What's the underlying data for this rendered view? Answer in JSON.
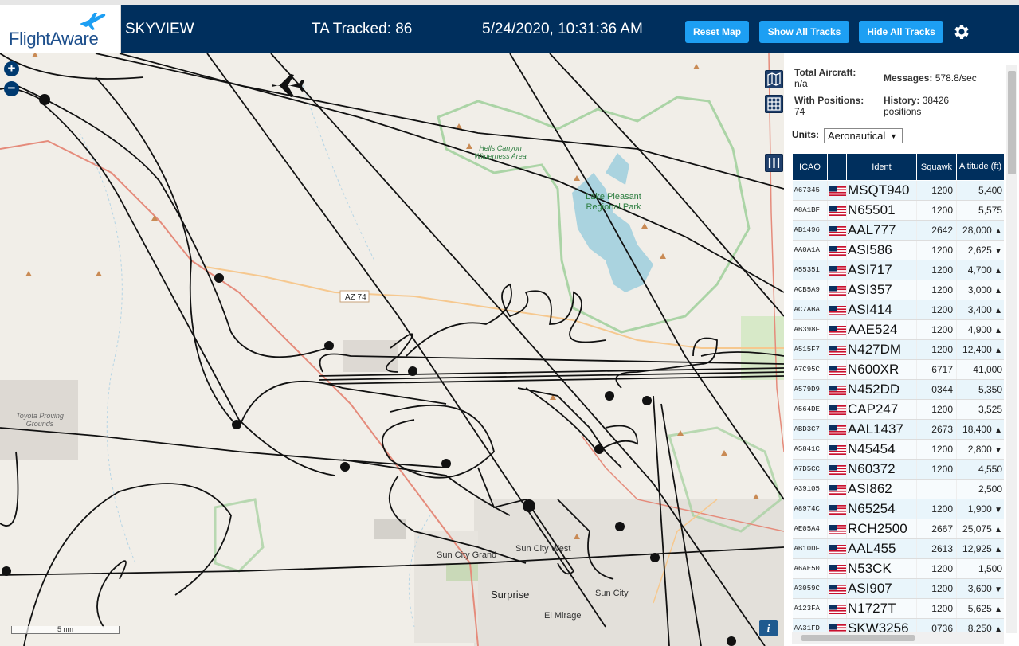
{
  "header": {
    "logo_text": "FlightAware",
    "app_name": "SKYVIEW",
    "tracked": "TA Tracked: 86",
    "datetime": "5/24/2020, 10:31:36 AM",
    "buttons": {
      "reset": "Reset Map",
      "show": "Show All Tracks",
      "hide": "Hide All Tracks"
    }
  },
  "map": {
    "zoom_in": "+",
    "zoom_out": "−",
    "scale": "5 nm",
    "info": "i",
    "labels": {
      "hells_canyon": "Hells Canyon Wilderness Area",
      "lake_pleasant": "Lake Pleasant Regional Park",
      "toyota": "Toyota Proving Grounds",
      "az74": "AZ 74",
      "sun_city_grand": "Sun City Grand",
      "sun_city_west": "Sun City West",
      "surprise": "Surprise",
      "sun_city": "Sun City",
      "el_mirage": "El Mirage"
    },
    "colors": {
      "land": "#f1eee8",
      "water": "#aad3df",
      "park_border": "#9fcf9a",
      "road_major": "#e58b7b",
      "road_secondary": "#f6c88f",
      "track": "#111111"
    }
  },
  "stats": {
    "total_label": "Total Aircraft:",
    "total_value": "n/a",
    "positions_label": "With Positions:",
    "positions_value": "74",
    "messages_label": "Messages:",
    "messages_value": "578.8/sec",
    "history_label": "History:",
    "history_value": "38426 positions"
  },
  "units": {
    "label": "Units:",
    "selected": "Aeronautical"
  },
  "table": {
    "columns": {
      "icao": "ICAO",
      "flag": "",
      "ident": "Ident",
      "squawk": "Squawk",
      "altitude": "Altitude (ft)"
    },
    "rows": [
      {
        "icao": "A67345",
        "ident": "MSQT940",
        "squawk": "1200",
        "altitude": "5,400",
        "trend": ""
      },
      {
        "icao": "A8A1BF",
        "ident": "N65501",
        "squawk": "1200",
        "altitude": "5,575",
        "trend": ""
      },
      {
        "icao": "AB1496",
        "ident": "AAL777",
        "squawk": "2642",
        "altitude": "28,000",
        "trend": "▲"
      },
      {
        "icao": "AA0A1A",
        "ident": "ASI586",
        "squawk": "1200",
        "altitude": "2,625",
        "trend": "▼"
      },
      {
        "icao": "A55351",
        "ident": "ASI717",
        "squawk": "1200",
        "altitude": "4,700",
        "trend": "▲"
      },
      {
        "icao": "ACB5A9",
        "ident": "ASI357",
        "squawk": "1200",
        "altitude": "3,000",
        "trend": "▲"
      },
      {
        "icao": "AC7ABA",
        "ident": "ASI414",
        "squawk": "1200",
        "altitude": "3,400",
        "trend": "▲"
      },
      {
        "icao": "AB398F",
        "ident": "AAE524",
        "squawk": "1200",
        "altitude": "4,900",
        "trend": "▲"
      },
      {
        "icao": "A515F7",
        "ident": "N427DM",
        "squawk": "1200",
        "altitude": "12,400",
        "trend": "▲"
      },
      {
        "icao": "A7C95C",
        "ident": "N600XR",
        "squawk": "6717",
        "altitude": "41,000",
        "trend": ""
      },
      {
        "icao": "A579D9",
        "ident": "N452DD",
        "squawk": "0344",
        "altitude": "5,350",
        "trend": ""
      },
      {
        "icao": "A564DE",
        "ident": "CAP247",
        "squawk": "1200",
        "altitude": "3,525",
        "trend": ""
      },
      {
        "icao": "ABD3C7",
        "ident": "AAL1437",
        "squawk": "2673",
        "altitude": "18,400",
        "trend": "▲"
      },
      {
        "icao": "A5841C",
        "ident": "N45454",
        "squawk": "1200",
        "altitude": "2,800",
        "trend": "▼"
      },
      {
        "icao": "A7D5CC",
        "ident": "N60372",
        "squawk": "1200",
        "altitude": "4,550",
        "trend": ""
      },
      {
        "icao": "A39105",
        "ident": "ASI862",
        "squawk": "",
        "altitude": "2,500",
        "trend": ""
      },
      {
        "icao": "A8974C",
        "ident": "N65254",
        "squawk": "1200",
        "altitude": "1,900",
        "trend": "▼"
      },
      {
        "icao": "AE05A4",
        "ident": "RCH2500",
        "squawk": "2667",
        "altitude": "25,075",
        "trend": "▲"
      },
      {
        "icao": "AB10DF",
        "ident": "AAL455",
        "squawk": "2613",
        "altitude": "12,925",
        "trend": "▲"
      },
      {
        "icao": "A6AE50",
        "ident": "N53CK",
        "squawk": "1200",
        "altitude": "1,500",
        "trend": ""
      },
      {
        "icao": "A3059C",
        "ident": "ASI907",
        "squawk": "1200",
        "altitude": "3,600",
        "trend": "▼"
      },
      {
        "icao": "A123FA",
        "ident": "N1727T",
        "squawk": "1200",
        "altitude": "5,625",
        "trend": "▲"
      },
      {
        "icao": "AA31FD",
        "ident": "SKW3256",
        "squawk": "0736",
        "altitude": "8,250",
        "trend": "▲"
      }
    ]
  }
}
